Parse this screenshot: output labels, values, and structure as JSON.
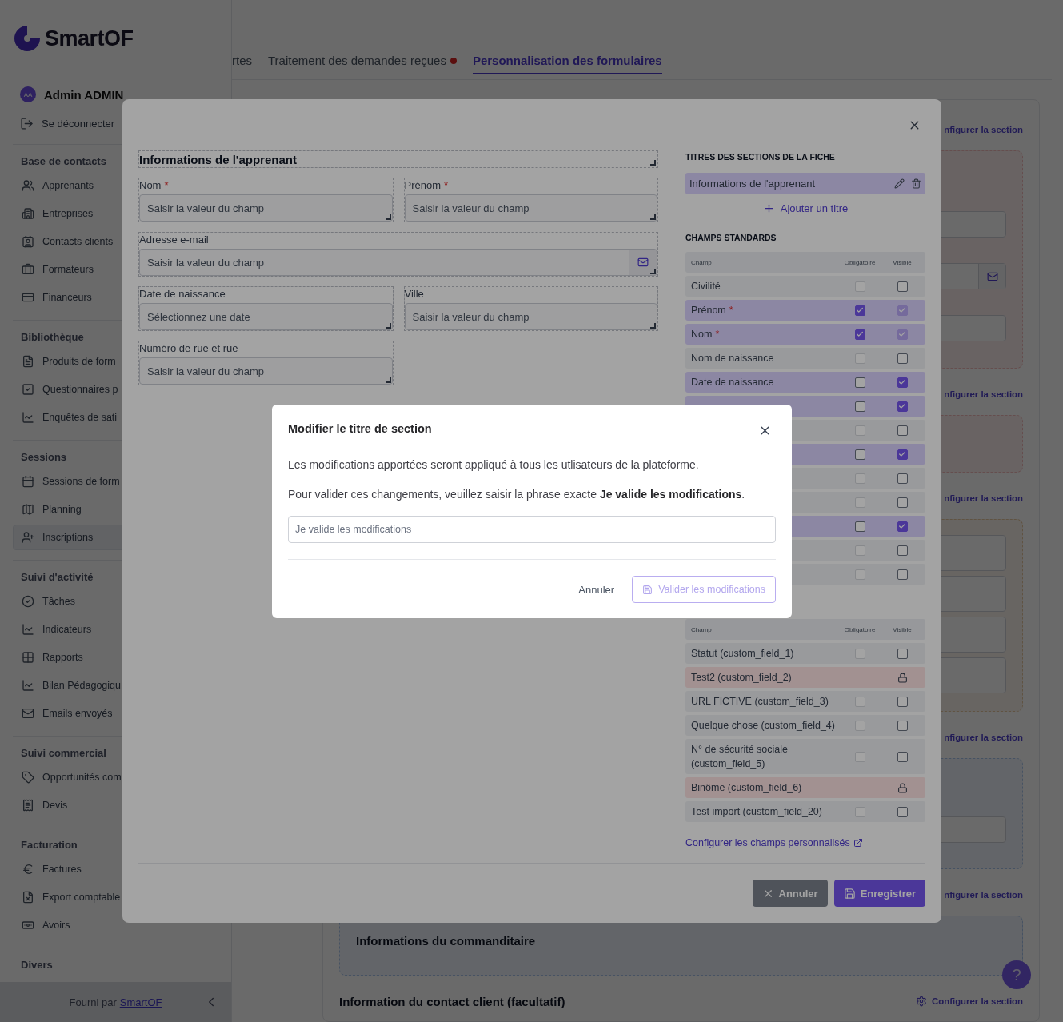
{
  "sidebar": {
    "brand": "SmartOF",
    "user": {
      "initials": "AA",
      "name": "Admin ADMIN"
    },
    "logout": "Se déconnecter",
    "groups": [
      {
        "title": "Base de contacts",
        "items": [
          {
            "label": "Apprenants",
            "selected": false
          },
          {
            "label": "Entreprises",
            "selected": false
          },
          {
            "label": "Contacts clients",
            "selected": false
          },
          {
            "label": "Formateurs",
            "selected": false
          },
          {
            "label": "Financeurs",
            "selected": false
          }
        ]
      },
      {
        "title": "Bibliothèque",
        "items": [
          {
            "label": "Produits de form",
            "selected": false
          },
          {
            "label": "Questionnaires p",
            "selected": false
          },
          {
            "label": "Enquêtes de sati",
            "selected": false
          }
        ]
      },
      {
        "title": "Sessions",
        "items": [
          {
            "label": "Sessions de form",
            "selected": false
          },
          {
            "label": "Planning",
            "selected": false
          },
          {
            "label": "Inscriptions",
            "selected": true
          }
        ]
      },
      {
        "title": "Suivi d'activité",
        "items": [
          {
            "label": "Tâches",
            "selected": false
          },
          {
            "label": "Indicateurs",
            "selected": false
          },
          {
            "label": "Rapports",
            "selected": false
          },
          {
            "label": "Bilan Pédagogiqu",
            "selected": false
          },
          {
            "label": "Emails envoyés",
            "selected": false
          }
        ]
      },
      {
        "title": "Suivi commercial",
        "items": [
          {
            "label": "Opportunités com",
            "selected": false
          },
          {
            "label": "Devis",
            "selected": false
          }
        ]
      },
      {
        "title": "Facturation",
        "items": [
          {
            "label": "Factures",
            "selected": false
          },
          {
            "label": "Export comptable",
            "selected": false
          },
          {
            "label": "Avoirs",
            "selected": false
          }
        ]
      },
      {
        "title": "Divers"
      }
    ],
    "footer": {
      "text": "Fourni par",
      "link": "SmartOF"
    }
  },
  "tabs": [
    {
      "label": "rtes",
      "selected": false,
      "dot": false
    },
    {
      "label": "Traitement des demandes reçues",
      "selected": false,
      "dot": true
    },
    {
      "label": "Personnalisation des formulaires",
      "selected": true,
      "dot": false
    }
  ],
  "page_sections": [
    {
      "link": "nfigurer la section",
      "kind": "red",
      "inputs": [
        {
          "kind": "text"
        },
        {
          "kind": "email"
        },
        {
          "kind": "text"
        }
      ]
    },
    {
      "link": "nfigurer la section",
      "kind": "red"
    },
    {
      "link": "nfigurer la section",
      "kind": "orange",
      "inputs": [
        {
          "kind": "text"
        },
        {
          "kind": "text"
        },
        {
          "kind": "text"
        },
        {
          "kind": "text"
        }
      ]
    },
    {
      "link": "nfigurer la section",
      "kind": "blue",
      "inputs": [
        {
          "kind": "text"
        }
      ]
    },
    {
      "link": "nfigurer la section",
      "kind": "blue",
      "box_title": "Informations du commanditaire"
    },
    {
      "title": "Information du contact client (facultatif)",
      "link": "Configurer la section",
      "gear": true
    }
  ],
  "help_button": "?",
  "editor": {
    "section_title": "Informations de l'apprenant",
    "rows": [
      [
        {
          "label": "Nom",
          "required_mark": "*",
          "placeholder": "Saisir la valeur du champ",
          "kind": "text"
        },
        {
          "label": "Prénom",
          "required_mark": "*",
          "placeholder": "Saisir la valeur du champ",
          "kind": "text"
        }
      ],
      [
        {
          "label": "Adresse e-mail",
          "placeholder": "Saisir la valeur du champ",
          "kind": "email"
        }
      ],
      [
        {
          "label": "Date de naissance",
          "placeholder": "Sélectionnez une date",
          "kind": "date"
        },
        {
          "label": "Ville",
          "placeholder": "Saisir la valeur du champ",
          "kind": "text"
        }
      ],
      [
        {
          "label": "Numéro de rue et rue",
          "placeholder": "Saisir la valeur du champ",
          "kind": "text"
        }
      ]
    ]
  },
  "settings": {
    "titles_heading": "TITRES DES SECTIONS DE LA FICHE",
    "section_titles": [
      {
        "label": "Informations de l'apprenant"
      }
    ],
    "add_title": "Ajouter un titre",
    "standard_heading": "CHAMPS STANDARDS",
    "standard_table": {
      "columns": [
        "Champ",
        "Obligatoire",
        "Visible"
      ],
      "rows": [
        {
          "label": "Civilité",
          "mandatory": false,
          "mandatory_disabled": true,
          "visible": false,
          "visible_disabled": false
        },
        {
          "label": "Prénom",
          "required_mark": "*",
          "mandatory": true,
          "mandatory_disabled": false,
          "visible": true,
          "visible_disabled": true
        },
        {
          "label": "Nom",
          "required_mark": "*",
          "mandatory": true,
          "mandatory_disabled": false,
          "visible": true,
          "visible_disabled": true
        },
        {
          "label": "Nom de naissance",
          "mandatory": false,
          "mandatory_disabled": true,
          "visible": false,
          "visible_disabled": false
        },
        {
          "label": "Date de naissance",
          "mandatory": false,
          "mandatory_disabled": false,
          "visible": true,
          "visible_disabled": false
        },
        {
          "mandatory": false,
          "mandatory_disabled": false,
          "visible": true,
          "visible_disabled": false
        },
        {
          "mandatory": false,
          "mandatory_disabled": true,
          "visible": false,
          "visible_disabled": false
        },
        {
          "mandatory": false,
          "mandatory_disabled": false,
          "visible": true,
          "visible_disabled": false
        },
        {
          "mandatory": false,
          "mandatory_disabled": true,
          "visible": false,
          "visible_disabled": false
        },
        {
          "mandatory": false,
          "mandatory_disabled": true,
          "visible": false,
          "visible_disabled": false
        },
        {
          "mandatory": false,
          "mandatory_disabled": false,
          "visible": true,
          "visible_disabled": false
        },
        {
          "mandatory": false,
          "mandatory_disabled": true,
          "visible": false,
          "visible_disabled": false
        },
        {
          "mandatory": false,
          "mandatory_disabled": true,
          "visible": false,
          "visible_disabled": false
        }
      ]
    },
    "custom_table": {
      "columns": [
        "Champ",
        "Obligatoire",
        "Visible"
      ],
      "rows": [
        {
          "label": "Statut (custom_field_1)",
          "locked": false,
          "mandatory": false,
          "mandatory_disabled": true,
          "visible": false,
          "visible_disabled": false
        },
        {
          "label": "Test2 (custom_field_2)",
          "locked": true
        },
        {
          "label": "URL FICTIVE (custom_field_3)",
          "locked": false,
          "mandatory": false,
          "mandatory_disabled": true,
          "visible": false,
          "visible_disabled": false
        },
        {
          "label": "Quelque chose (custom_field_4)",
          "locked": false,
          "mandatory": false,
          "mandatory_disabled": true,
          "visible": false,
          "visible_disabled": false
        },
        {
          "label": "N° de sécurité sociale (custom_field_5)",
          "locked": false,
          "mandatory": false,
          "mandatory_disabled": true,
          "visible": false,
          "visible_disabled": false
        },
        {
          "label": "Binôme (custom_field_6)",
          "locked": true
        },
        {
          "label": "Test import (custom_field_20)",
          "locked": false,
          "mandatory": false,
          "mandatory_disabled": true,
          "visible": false,
          "visible_disabled": false
        }
      ]
    },
    "custom_link": "Configurer les champs personnalisés"
  },
  "modal_buttons": {
    "cancel": "Annuler",
    "save": "Enregistrer"
  },
  "dialog": {
    "title": "Modifier le titre de section",
    "paragraphs": [
      "Les modifications apportées seront appliqué à tous les utlisateurs de la plateforme.",
      "Pour valider ces changements, veuillez saisir la phrase exacte **Je valide les modifications**."
    ],
    "input": {
      "placeholder": "Je valide les modifications"
    },
    "cancel": "Annuler",
    "confirm": {
      "label": "Valider les modifications",
      "disabled": true
    }
  }
}
